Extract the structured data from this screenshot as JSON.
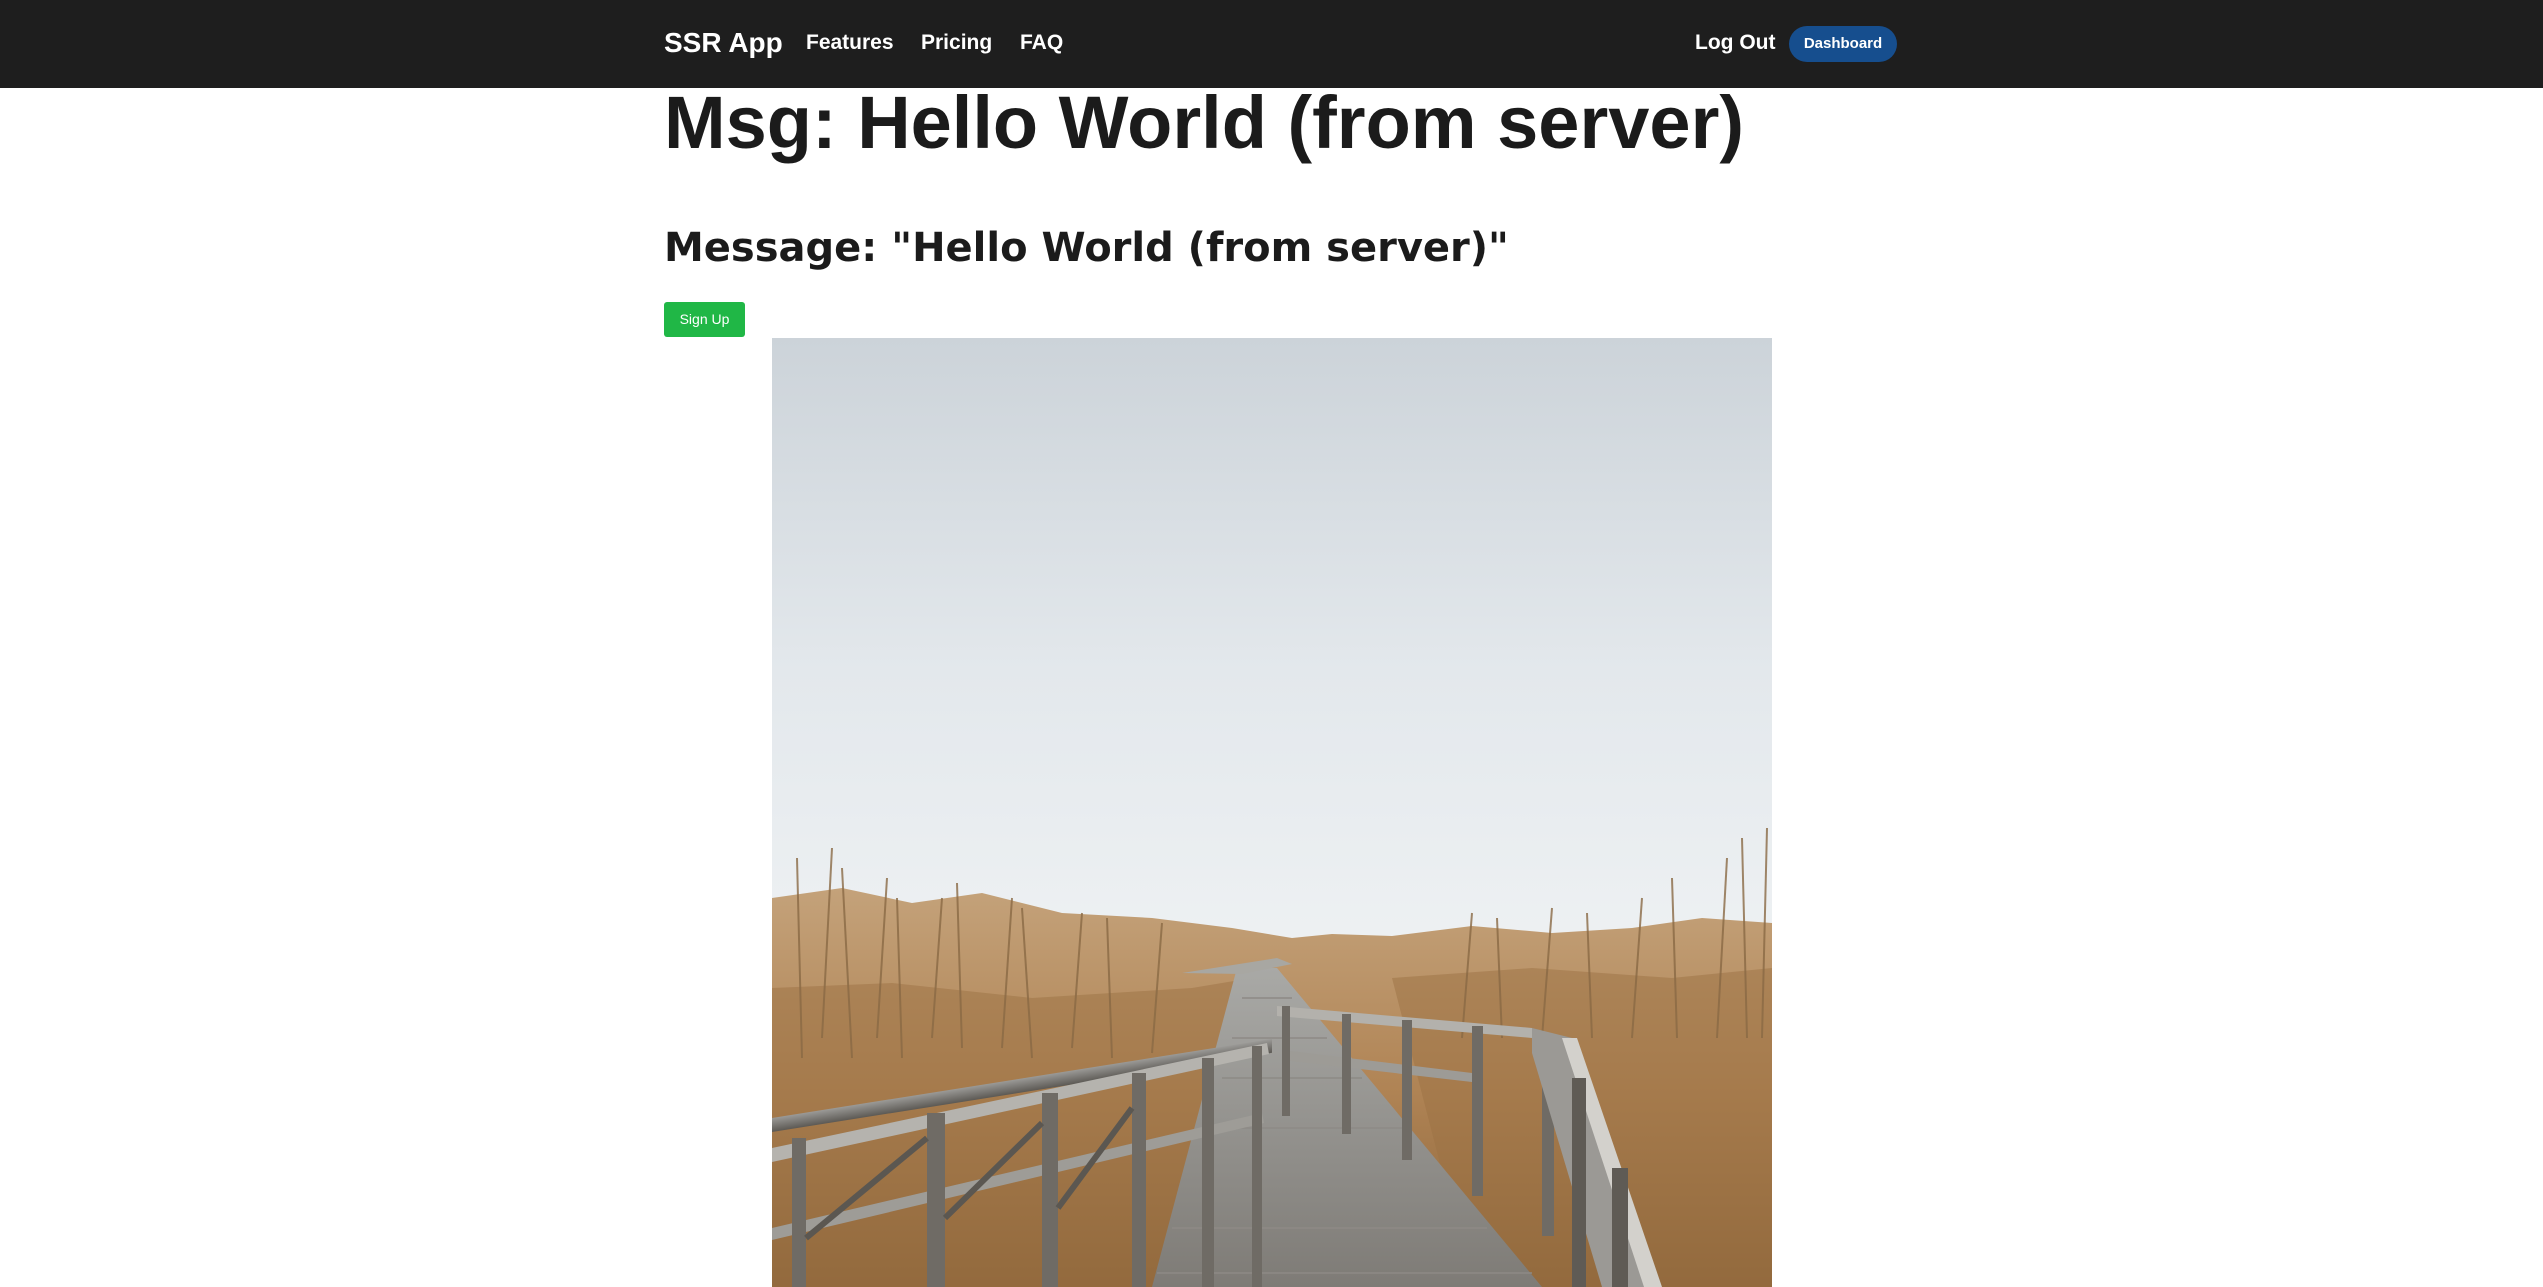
{
  "navbar": {
    "brand": "SSR App",
    "links": [
      "Features",
      "Pricing",
      "FAQ"
    ],
    "logout": "Log Out",
    "dashboard": "Dashboard",
    "background": "#1e1e1e",
    "dashboard_color": "#164e8e"
  },
  "main": {
    "title": "Msg: Hello World (from server)",
    "message": "Message: \"Hello World (from server)\"",
    "signup": "Sign Up",
    "signup_color": "#20b746"
  },
  "photo": {
    "subject": "wooden boardwalk through dry reeds under an overcast sky"
  }
}
